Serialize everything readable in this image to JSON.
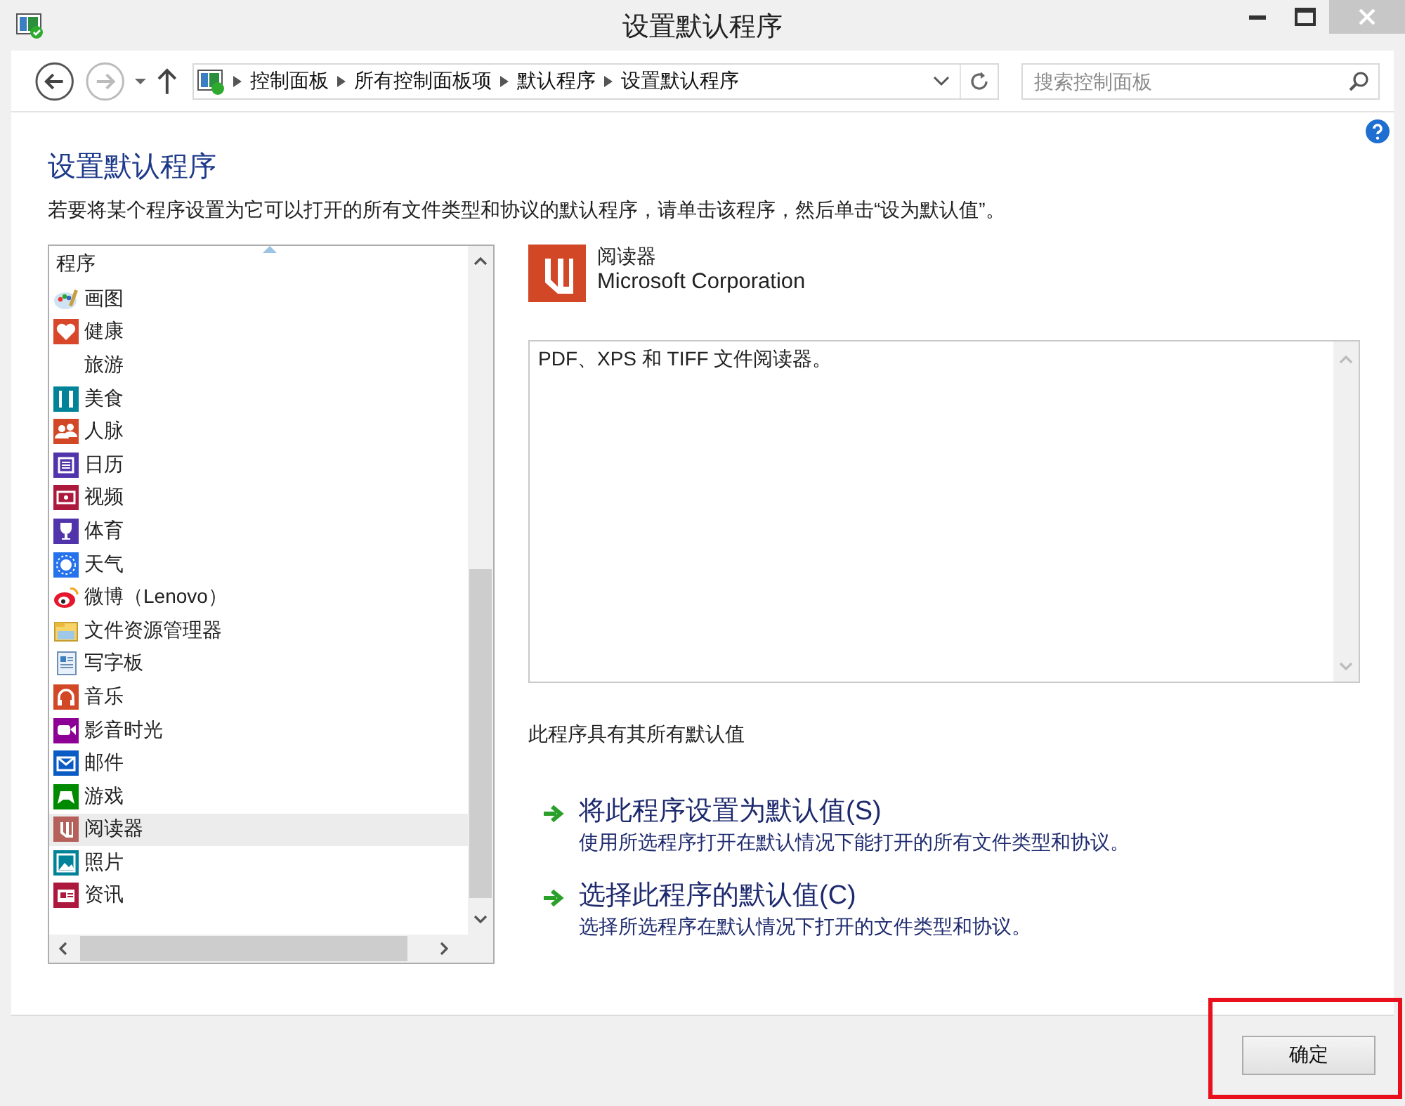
{
  "window": {
    "title": "设置默认程序"
  },
  "address_bar": {
    "crumbs": [
      "控制面板",
      "所有控制面板项",
      "默认程序",
      "设置默认程序"
    ]
  },
  "search": {
    "placeholder": "搜索控制面板"
  },
  "page": {
    "heading": "设置默认程序",
    "description": "若要将某个程序设置为它可以打开的所有文件类型和协议的默认程序，请单击该程序，然后单击“设为默认值”。"
  },
  "program_list": {
    "header": "程序",
    "items": [
      {
        "name": "画图",
        "selected": false
      },
      {
        "name": "健康",
        "selected": false,
        "color": "#d9472b"
      },
      {
        "name": "旅游",
        "selected": false
      },
      {
        "name": "美食",
        "selected": false,
        "color": "#008299"
      },
      {
        "name": "人脉",
        "selected": false,
        "color": "#d24726"
      },
      {
        "name": "日历",
        "selected": false,
        "color": "#5133ab"
      },
      {
        "name": "视频",
        "selected": false,
        "color": "#ac193d"
      },
      {
        "name": "体育",
        "selected": false,
        "color": "#5133ab"
      },
      {
        "name": "天气",
        "selected": false,
        "color": "#2672ec"
      },
      {
        "name": "微博（Lenovo）",
        "selected": false
      },
      {
        "name": "文件资源管理器",
        "selected": false
      },
      {
        "name": "写字板",
        "selected": false
      },
      {
        "name": "音乐",
        "selected": false,
        "color": "#d24726"
      },
      {
        "name": "影音时光",
        "selected": false,
        "color": "#8c0095"
      },
      {
        "name": "邮件",
        "selected": false,
        "color": "#0a5bc4"
      },
      {
        "name": "游戏",
        "selected": false,
        "color": "#008a00"
      },
      {
        "name": "阅读器",
        "selected": true,
        "color": "#b5605a"
      },
      {
        "name": "照片",
        "selected": false,
        "color": "#008299"
      },
      {
        "name": "资讯",
        "selected": false,
        "color": "#ac193d"
      }
    ]
  },
  "program_info": {
    "name": "阅读器",
    "publisher": "Microsoft Corporation",
    "description": "PDF、XPS 和 TIFF 文件阅读器。",
    "status": "此程序具有其所有默认值",
    "actions": [
      {
        "title": "将此程序设置为默认值(S)",
        "subtitle": "使用所选程序打开在默认情况下能打开的所有文件类型和协议。"
      },
      {
        "title": "选择此程序的默认值(C)",
        "subtitle": "选择所选程序在默认情况下打开的文件类型和协议。"
      }
    ]
  },
  "ok_button": "确定",
  "annotation": {
    "kind": "frame"
  }
}
